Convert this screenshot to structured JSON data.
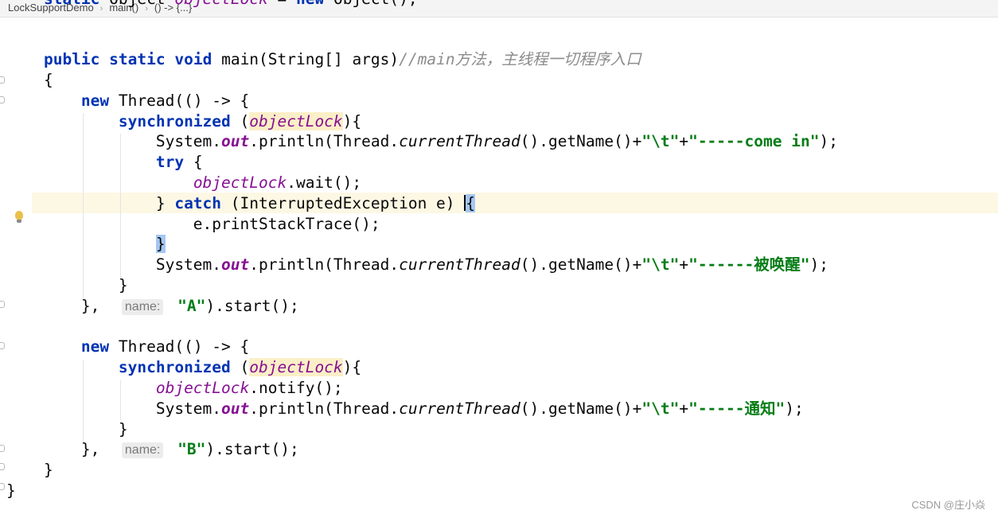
{
  "breadcrumb": [
    "LockSupportDemo",
    "main()",
    "() -> {...}"
  ],
  "code_lines": [
    "    static Object objectLock = new Object();",
    "",
    "    public static void main(String[] args)//main方法，主线程一切程序入口",
    "    {",
    "        new Thread(() -> {",
    "            synchronized (objectLock){",
    "                System.out.println(Thread.currentThread().getName()+\"\\t\"+\"-----come in\");",
    "                try {",
    "                    objectLock.wait();",
    "                } catch (InterruptedException e) {",
    "                    e.printStackTrace();",
    "                }",
    "                System.out.println(Thread.currentThread().getName()+\"\\t\"+\"------被唤醒\");",
    "            }",
    "        },  name: \"A\").start();",
    "",
    "        new Thread(() -> {",
    "            synchronized (objectLock){",
    "                objectLock.notify();",
    "                System.out.println(Thread.currentThread().getName()+\"\\t\"+\"-----通知\");",
    "            }",
    "        },  name: \"B\").start();",
    "    }",
    "}"
  ],
  "inlay_hint": "name:",
  "watermark": "CSDN @庄小焱",
  "colors": {
    "keyword": "#0033b3",
    "string": "#067d17",
    "field": "#871094",
    "comment": "#8c8c8c",
    "current_line": "#fdf8e4",
    "brace_match": "#a4c7f2",
    "lock_highlight": "#fbefc7"
  },
  "icons": [
    "chevron-right-icon",
    "fold-marker-icon",
    "intention-bulb-icon"
  ]
}
